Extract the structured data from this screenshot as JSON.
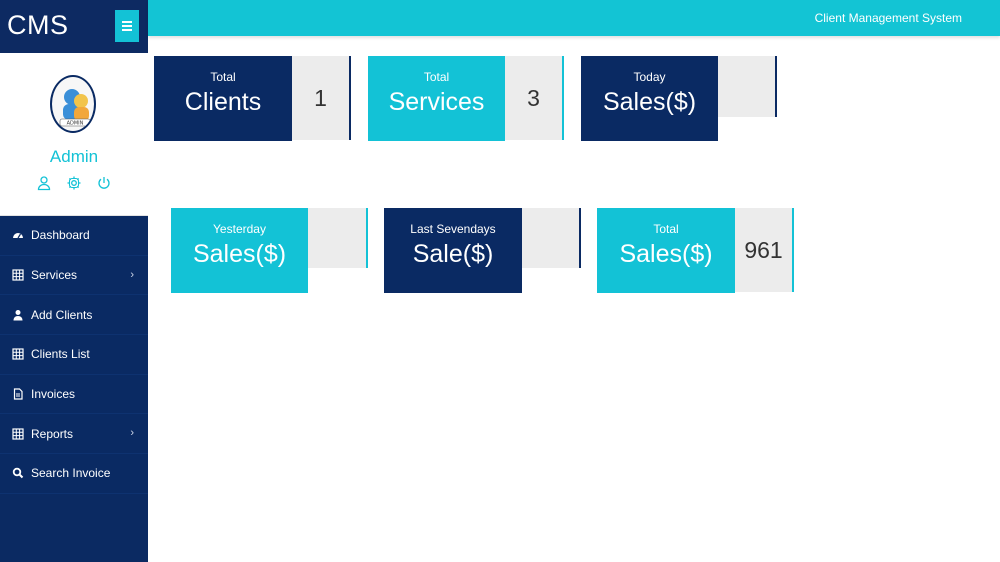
{
  "brand": {
    "text": "CMS",
    "menu_icon": "hamburger-icon"
  },
  "profile": {
    "name": "Admin",
    "avatar_icon": "admin-avatar-icon",
    "icons": [
      "user-icon",
      "gear-icon",
      "power-icon"
    ]
  },
  "topbar": {
    "title": "Client Management System"
  },
  "nav": {
    "items": [
      {
        "label": "Dashboard",
        "icon": "dashboard-icon"
      },
      {
        "label": "Services",
        "icon": "table-icon",
        "chevron": "›"
      },
      {
        "label": "Add Clients",
        "icon": "user-icon"
      },
      {
        "label": "Clients List",
        "icon": "table-icon"
      },
      {
        "label": "Invoices",
        "icon": "file-icon"
      },
      {
        "label": "Reports",
        "icon": "table-icon",
        "chevron": "›"
      },
      {
        "label": "Search Invoice",
        "icon": "search-icon"
      }
    ]
  },
  "cards": [
    {
      "small": "Total",
      "big": "Clients",
      "value": "1"
    },
    {
      "small": "Total",
      "big": "Services",
      "value": "3"
    },
    {
      "small": "Today",
      "big": "Sales($)",
      "value": ""
    },
    {
      "small": "Yesterday",
      "big": "Sales($)",
      "value": ""
    },
    {
      "small": "Last Sevendays",
      "big": "Sale($)",
      "value": ""
    },
    {
      "small": "Total",
      "big": "Sales($)",
      "value": "961"
    }
  ],
  "colors": {
    "navy": "#0a2a63",
    "cyan": "#13c2d6",
    "value_bg": "#ececec"
  }
}
